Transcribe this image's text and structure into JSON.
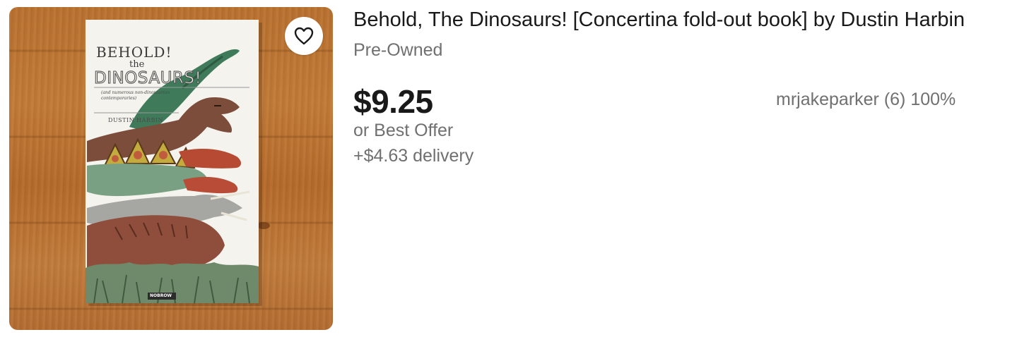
{
  "listing": {
    "title": "Behold, The Dinosaurs! [Concertina fold-out book] by Dustin Harbin",
    "condition": "Pre-Owned",
    "price": "$9.25",
    "best_offer": "or Best Offer",
    "delivery": "+$4.63 delivery",
    "seller": "mrjakeparker (6) 100%"
  },
  "book_cover": {
    "title_line1": "BEHOLD!",
    "title_line2": "the",
    "title_line3": "DINOSAURS!",
    "subtitle": "(and numerous non-dinosaurian contemporaries)",
    "author": "DUSTIN HARBIN",
    "publisher": "NOBROW"
  },
  "icons": {
    "favorite": "heart-outline-icon"
  },
  "colors": {
    "text_primary": "#191919",
    "text_secondary": "#707070",
    "wood": "#b9712f"
  }
}
